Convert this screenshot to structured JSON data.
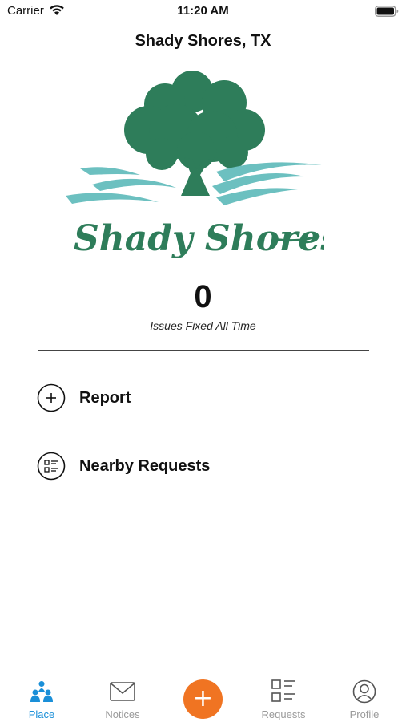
{
  "status_bar": {
    "carrier": "Carrier",
    "time": "11:20 AM",
    "wifi_icon": "wifi-icon",
    "battery_icon": "battery-icon"
  },
  "header": {
    "title": "Shady Shores, TX"
  },
  "logo": {
    "text": "Shady Shores",
    "colors": {
      "tree": "#2e7d5a",
      "water": "#6cc0c0"
    }
  },
  "stats": {
    "value": "0",
    "label": "Issues Fixed All Time"
  },
  "actions": [
    {
      "label": "Report",
      "icon": "plus-circle-icon"
    },
    {
      "label": "Nearby Requests",
      "icon": "list-circle-icon"
    }
  ],
  "tab_bar": {
    "tabs": [
      {
        "label": "Place",
        "icon": "place-people-icon",
        "active": true
      },
      {
        "label": "Notices",
        "icon": "mail-icon",
        "active": false
      },
      {
        "label": "Requests",
        "icon": "requests-list-icon",
        "active": false
      },
      {
        "label": "Profile",
        "icon": "profile-icon",
        "active": false
      }
    ],
    "fab_icon": "plus-icon",
    "fab_label": "+"
  },
  "colors": {
    "accent_active": "#1a8fd8",
    "fab": "#f07422",
    "inactive": "#9a9a9a"
  }
}
